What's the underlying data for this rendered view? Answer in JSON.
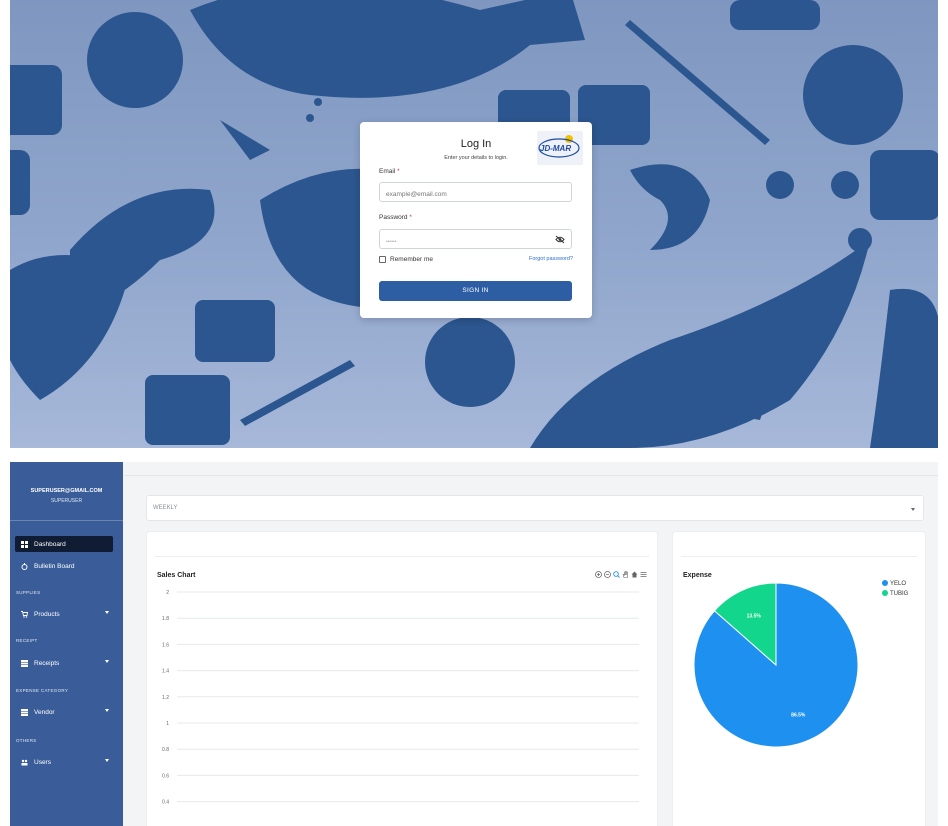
{
  "login": {
    "title": "Log In",
    "subtitle": "Enter your details to login.",
    "logo_text": "JD-MAR",
    "email": {
      "label": "Email",
      "required_mark": "*",
      "placeholder": "example@email.com"
    },
    "password": {
      "label": "Password",
      "required_mark": "*",
      "value_masked": "••••••"
    },
    "remember_label": "Remember me",
    "forgot_label": "Forgot password?",
    "signin_label": "SIGN IN",
    "colors": {
      "button": "#2d5ea3",
      "background": "#8ea3ca",
      "pattern": "#2c568f"
    }
  },
  "dashboard": {
    "user": {
      "email": "SUPERUSER@GMAIL.COM",
      "role": "SUPERUSER"
    },
    "nav": {
      "dashboard": "Dashboard",
      "bulletin": "Bulletin Board",
      "section_supplies": "SUPPLIES",
      "products": "Products",
      "section_receipt": "RECEIPT",
      "receipts": "Receipts",
      "section_expense": "EXPENSE CATEGORY",
      "vendor": "Vendor",
      "section_others": "OTHERS",
      "users": "Users"
    },
    "period_select": "WEEKLY",
    "colors": {
      "sidebar": "#3a5d99",
      "active_nav": "#0f1c33"
    }
  },
  "chart_data": [
    {
      "type": "line",
      "title": "Sales Chart",
      "y_ticks": [
        "2",
        "1.8",
        "1.6",
        "1.4",
        "1.2",
        "1",
        "0.8",
        "0.6",
        "0.4"
      ],
      "ylim": [
        0.4,
        2
      ],
      "series": [],
      "grid": true
    },
    {
      "type": "pie",
      "title": "Expense",
      "legend_placement": "top-right",
      "slices": [
        {
          "label": "YELO",
          "value": 86.5,
          "display": "86.5%",
          "color": "#1e90f0"
        },
        {
          "label": "TUBIG",
          "value": 13.5,
          "display": "13.5%",
          "color": "#12d68c"
        }
      ]
    }
  ]
}
